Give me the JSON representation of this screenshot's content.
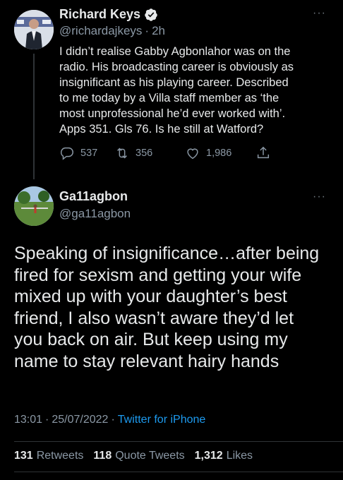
{
  "tweet1": {
    "display_name": "Richard Keys",
    "handle": "@richardajkeys",
    "separator": "·",
    "time": "2h",
    "text": "I didn’t realise Gabby Agbonlahor was on the\nradio. His broadcasting career is obviously as\ninsignificant as his playing career. Described\nto me today by a Villa staff member as ‘the\nmost unprofessional he’d ever worked with’.\nApps 351. Gls 76. Is he still at Watford?",
    "replies": "537",
    "retweets": "356",
    "likes": "1,986",
    "more": "···"
  },
  "tweet2": {
    "display_name": "Ga11agbon",
    "handle": "@ga11agbon",
    "more": "···",
    "text": "Speaking of insignificance…after being\nfired for sexism and getting your wife\nmixed  up with your daughter’s best\nfriend, I also wasn’t aware they’d let\nyou back on air. But keep using my\nname to stay relevant hairy hands",
    "time": "13:01",
    "date": "25/07/2022",
    "separator": "·",
    "source": "Twitter for iPhone",
    "stats": {
      "retweets_count": "131",
      "retweets_label": "Retweets",
      "quotes_count": "118",
      "quotes_label": "Quote Tweets",
      "likes_count": "1,312",
      "likes_label": "Likes"
    }
  },
  "colors": {
    "background": "#000000",
    "text": "#e7e9ea",
    "secondary": "#8b98a5",
    "link": "#1d9bf0",
    "verified": "#1d9bf0"
  },
  "icons": [
    "verified-badge-icon",
    "reply-icon",
    "retweet-icon",
    "like-icon",
    "share-icon",
    "more-icon"
  ]
}
